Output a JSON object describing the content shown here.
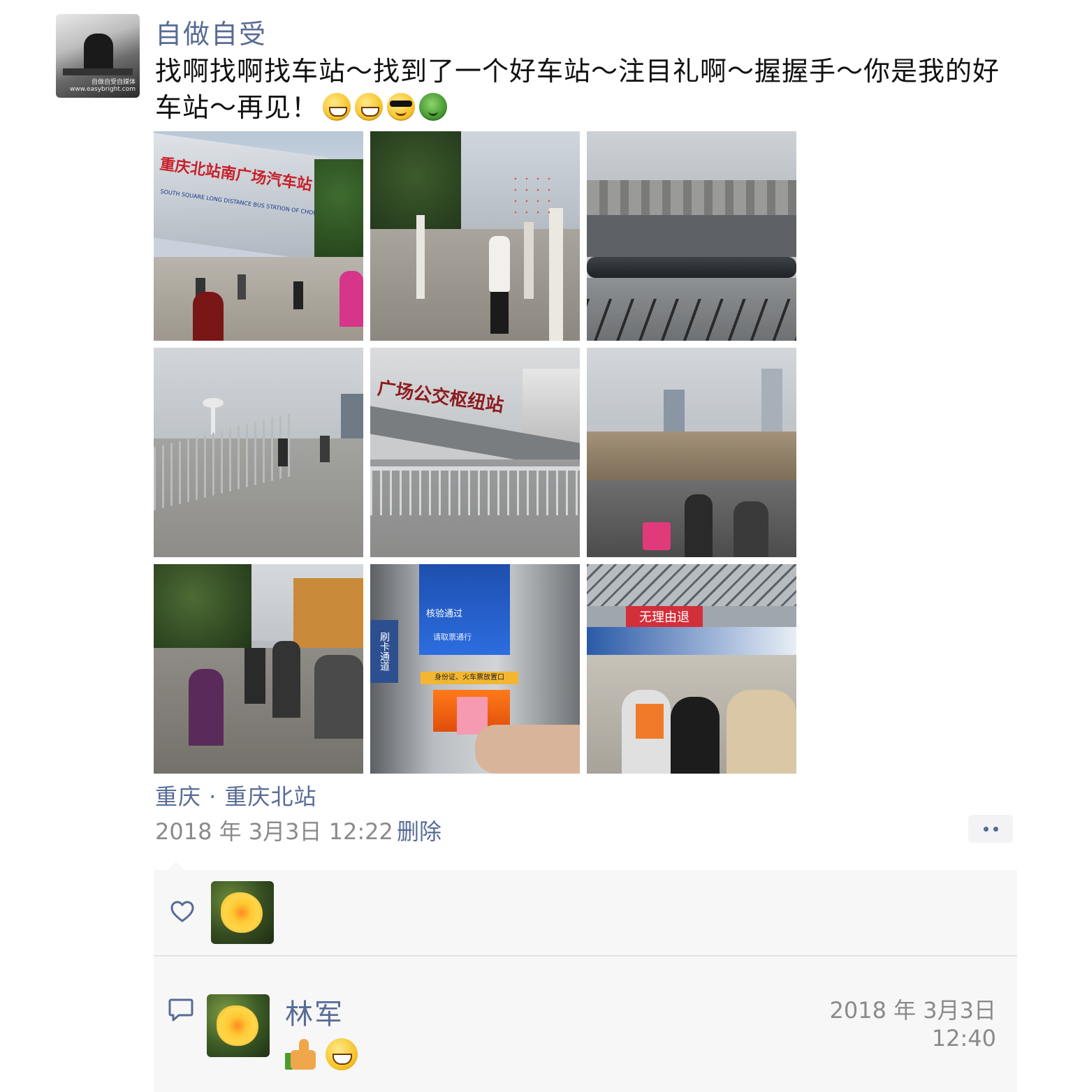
{
  "post": {
    "author": "自做自受",
    "text": "找啊找啊找车站～找到了一个好车站～注目礼啊～握握手～你是我的好车站～再见！",
    "text_emojis": [
      "grin-emoji",
      "grin-emoji",
      "sunglasses-emoji",
      "turtle-emoji"
    ],
    "avatar_watermark": "自做自受自媒体 www.easybright.com",
    "photos": [
      {
        "name": "photo-chongqing-north-square",
        "sign": "重庆北站南广场汽车站",
        "sign_en": "SOUTH SQUARE LONG DISTANCE BUS STATION OF CHONGQING NORTH STATION"
      },
      {
        "name": "photo-tree-lined-sidewalk"
      },
      {
        "name": "photo-roadside-railing"
      },
      {
        "name": "photo-pedestrian-bridge"
      },
      {
        "name": "photo-bus-hub-sign",
        "sign": "广场公交枢纽站"
      },
      {
        "name": "photo-construction-crowd"
      },
      {
        "name": "photo-crowd-station-plaza"
      },
      {
        "name": "photo-ticket-gate",
        "screen_top": "核验通过",
        "screen_bottom": "请取票通行",
        "slot_label": "身份证、火车票放置口",
        "side_label": "刷卡通道"
      },
      {
        "name": "photo-waiting-hall",
        "banner": "无理由退"
      }
    ],
    "location": "重庆 · 重庆北站",
    "timestamp": "2018 年 3月3日 12:22",
    "delete_label": "删除"
  },
  "interactions": {
    "likes": [
      {
        "avatar": "yellow-flower-avatar"
      }
    ],
    "comments": [
      {
        "author": "林军",
        "time": "2018 年 3月3日 12:40",
        "content_emojis": [
          "thumbs-up-emoji",
          "grin-emoji"
        ]
      }
    ]
  },
  "colors": {
    "link": "#576b95",
    "meta": "#8a8a8a",
    "panel_bg": "#f7f7f7"
  }
}
